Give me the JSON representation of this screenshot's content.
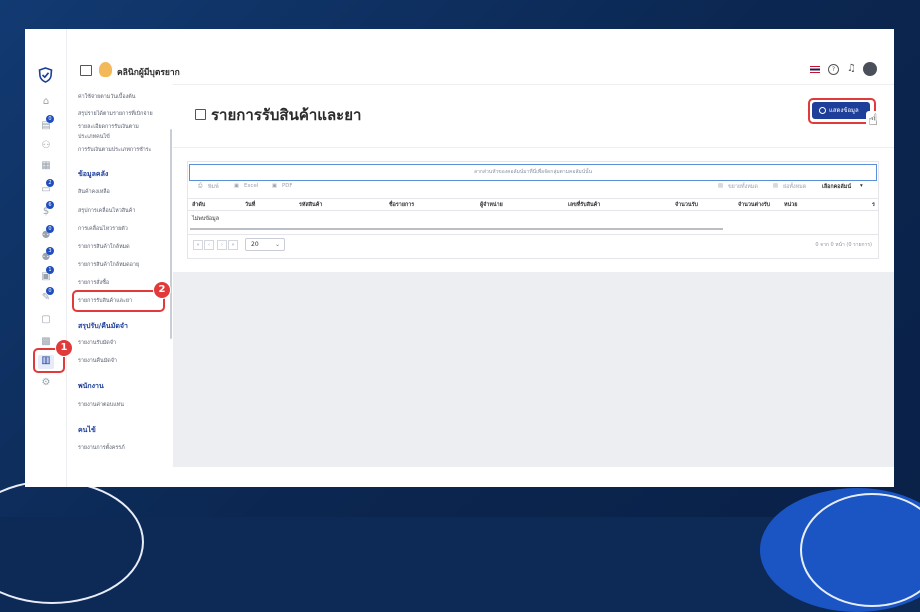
{
  "header": {
    "logo_text": "คลินิกผู้มีบุตรยาก"
  },
  "menu": {
    "top_items": [
      "ค่าใช้จ่ายตามวันเบื้องต้น",
      "สรุปรายได้ตามรายการที่เบิกจ่าย",
      "รายละเอียดการรับเงินตาม",
      "ประเภทคนไข้",
      "การรับเงินตามประเภทการชำระ"
    ],
    "sections": [
      {
        "title": "ข้อมูลคลัง",
        "items": [
          "สินค้าคงเหลือ",
          "สรุปการเคลื่อนไหวสินค้า",
          "การเคลื่อนไหวรายตัว",
          "รายการสินค้าใกล้หมด",
          "รายการสินค้าใกล้หมดอายุ",
          "รายการสั่งซื้อ",
          "รายการรับสินค้าและยา"
        ]
      },
      {
        "title": "สรุปรับ/คืนมัดจำ",
        "items": [
          "รายงานรับมัดจำ",
          "รายงานคืนมัดจำ"
        ]
      },
      {
        "title": "พนักงาน",
        "items": [
          "รายงานค่าตอบแทน"
        ]
      },
      {
        "title": "คนไข้",
        "items": [
          "รายงานการตั้งครรภ์"
        ]
      }
    ]
  },
  "page": {
    "title": "รายการรับสินค้าและยา",
    "show_button": "แสดงข้อมูล",
    "group_hint": "ลากส่วนหัวของคอลัมน์มาที่นี่เพื่อจัดกลุ่มตามคอลัมน์นั้น",
    "toolbar": {
      "print": "พิมพ์",
      "excel": "Excel",
      "pdf": "PDF",
      "expand_all": "ขยายทั้งหมด",
      "collapse_all": "ย่อทั้งหมด",
      "choose_columns": "เลือกคอลัมน์"
    },
    "columns": [
      "ลำดับ",
      "วันที่",
      "รหัสสินค้า",
      "ชื่อรายการ",
      "ผู้จำหน่าย",
      "เลขที่รับสินค้า",
      "จำนวนรับ",
      "จำนวนต่างรับ",
      "หน่วย",
      "ร"
    ],
    "empty_text": "ไม่พบข้อมูล",
    "pager": {
      "page_size": "20",
      "summary": "0 จาก 0 หน้า (0 รายการ)"
    }
  },
  "annotations": {
    "marker1": "1",
    "marker2": "2"
  },
  "colors": {
    "accent": "#1d3f9a",
    "marker": "#e03a3a",
    "background": "#0d2a57"
  }
}
